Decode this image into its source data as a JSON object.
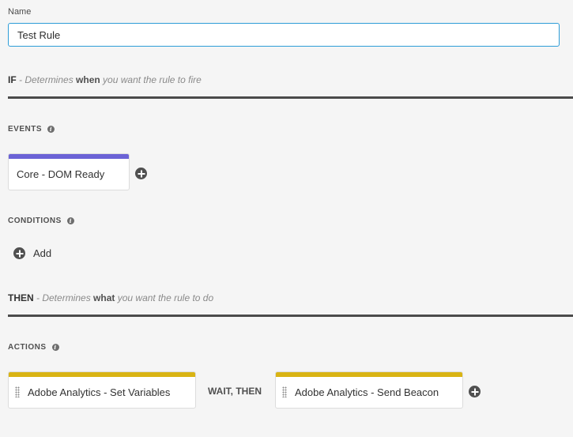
{
  "name_field": {
    "label": "Name",
    "value": "Test Rule"
  },
  "if_section": {
    "keyword": "IF",
    "desc_prefix": "- Determines ",
    "desc_emphasis": "when",
    "desc_suffix": " you want the rule to fire"
  },
  "events": {
    "label": "EVENTS",
    "items": [
      {
        "label": "Core - DOM Ready",
        "color": "#6b63d6"
      }
    ]
  },
  "conditions": {
    "label": "CONDITIONS",
    "add_label": "Add"
  },
  "then_section": {
    "keyword": "THEN",
    "desc_prefix": "- Determines ",
    "desc_emphasis": "what",
    "desc_suffix": " you want the rule to do"
  },
  "actions": {
    "label": "ACTIONS",
    "items": [
      {
        "label": "Adobe Analytics - Set Variables",
        "color": "#d9b414"
      },
      {
        "label": "Adobe Analytics - Send Beacon",
        "color": "#d9b414"
      }
    ],
    "separator": "WAIT, THEN"
  },
  "icons": {
    "info": "info-icon",
    "add": "plus-circle-icon",
    "drag": "drag-handle-icon"
  }
}
